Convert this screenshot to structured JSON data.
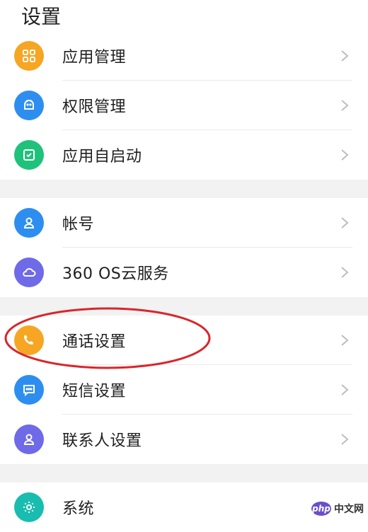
{
  "header": {
    "title": "设置"
  },
  "colors": {
    "app_manage": "#f6a623",
    "permission": "#2d8ef0",
    "auto_start": "#1fc27b",
    "account": "#2d8ef0",
    "cloud": "#6f6ae8",
    "call": "#f6a623",
    "sms": "#2d8ef0",
    "contacts": "#6f6ae8",
    "system": "#18bdb0",
    "annotation": "#d9262b"
  },
  "groups": [
    {
      "items": [
        {
          "label": "应用管理",
          "icon": "grid-icon"
        },
        {
          "label": "权限管理",
          "icon": "android-icon"
        },
        {
          "label": "应用自启动",
          "icon": "checkbox-icon"
        }
      ]
    },
    {
      "items": [
        {
          "label": "帐号",
          "icon": "person-icon"
        },
        {
          "label": "360 OS云服务",
          "icon": "cloud-icon"
        }
      ]
    },
    {
      "items": [
        {
          "label": "通话设置",
          "icon": "phone-icon"
        },
        {
          "label": "短信设置",
          "icon": "message-icon"
        },
        {
          "label": "联系人设置",
          "icon": "contact-icon"
        }
      ]
    },
    {
      "items": [
        {
          "label": "系统",
          "icon": "gear-icon"
        }
      ]
    }
  ],
  "watermark": {
    "badge": "php",
    "text": "中文网"
  }
}
